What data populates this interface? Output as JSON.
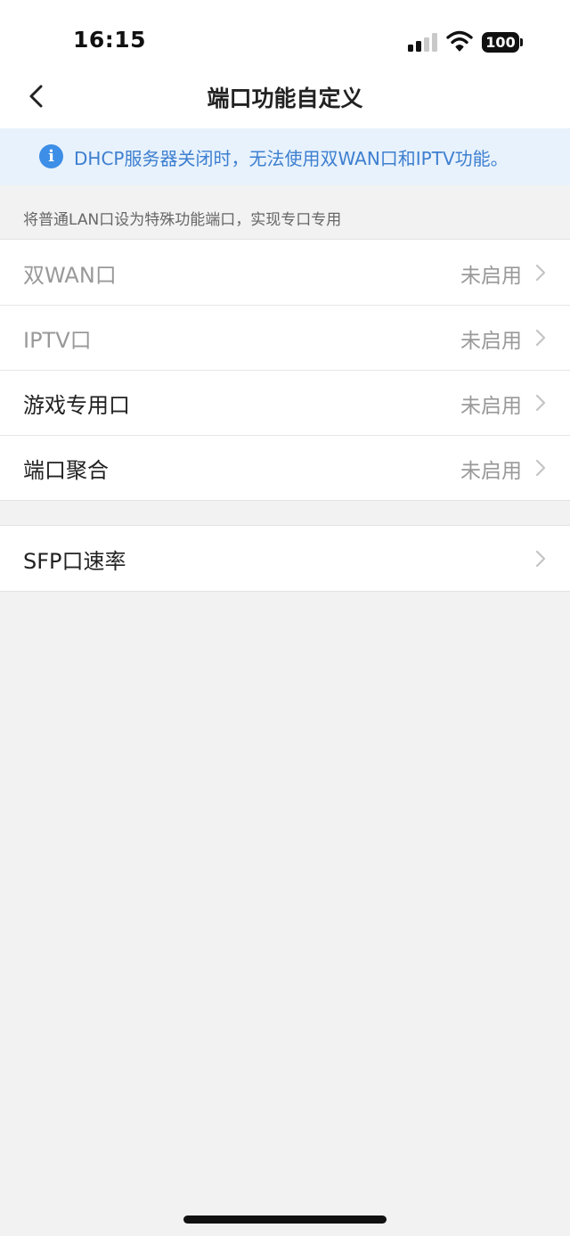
{
  "status_bar": {
    "time": "16:15",
    "battery": "100",
    "signal_icon": "cellular-signal-icon",
    "wifi_icon": "wifi-icon"
  },
  "nav": {
    "title": "端口功能自定义",
    "back_icon": "chevron-left-icon"
  },
  "notice": {
    "icon": "info-icon",
    "icon_glyph": "i",
    "text": "DHCP服务器关闭时，无法使用双WAN口和IPTV功能。"
  },
  "section": {
    "caption": "将普通LAN口设为特殊功能端口，实现专口专用"
  },
  "port_items": [
    {
      "label": "双WAN口",
      "value": "未启用"
    },
    {
      "label": "IPTV口",
      "value": "未启用"
    },
    {
      "label": "游戏专用口",
      "value": "未启用"
    },
    {
      "label": "端口聚合",
      "value": "未启用"
    }
  ],
  "sfp": {
    "label": "SFP口速率"
  },
  "colors": {
    "accent": "#3d8ee6",
    "notice_bg": "#e8f2fc",
    "page_bg": "#f2f2f2"
  }
}
